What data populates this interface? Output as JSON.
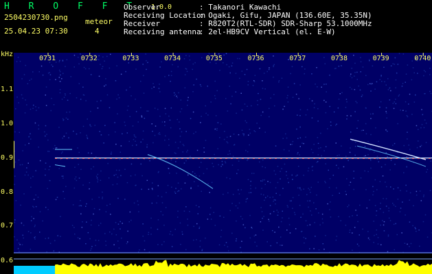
{
  "header": {
    "app_title": "H R O F F T",
    "version": "1.0.0",
    "filename": "2504230730.png",
    "datetime": "25.04.23 07:30",
    "meteor_label": "meteor",
    "meteor_count": "4",
    "fields": [
      {
        "label": "Observer",
        "value": ": Takanori Kawachi"
      },
      {
        "label": "Receiving Location",
        "value": ": Ogaki, Gifu, JAPAN (136.60E, 35.35N)"
      },
      {
        "label": "Receiver",
        "value": ": R820T2(RTL-SDR) SDR-Sharp 53.1000MHz"
      },
      {
        "label": "Receiving antenna",
        "value": ": 2el-HB9CV Vertical (el. E-W)"
      }
    ]
  },
  "chart_data": {
    "type": "heatmap",
    "y_unit": "kHz",
    "yticks": [
      "1.1",
      "1.0",
      "0.9",
      "0.8",
      "0.7",
      "0.6"
    ],
    "xticks": [
      "0731",
      "0732",
      "0733",
      "0734",
      "0735",
      "0736",
      "0737",
      "0738",
      "0739",
      "0740"
    ],
    "carrier_khz": 0.9,
    "colors": {
      "background": "#000066",
      "label": "#ffff66",
      "carrier": "#ff3333",
      "trace": "#66ccff",
      "level": "#ffff00",
      "level_start": "#00ccff"
    }
  }
}
